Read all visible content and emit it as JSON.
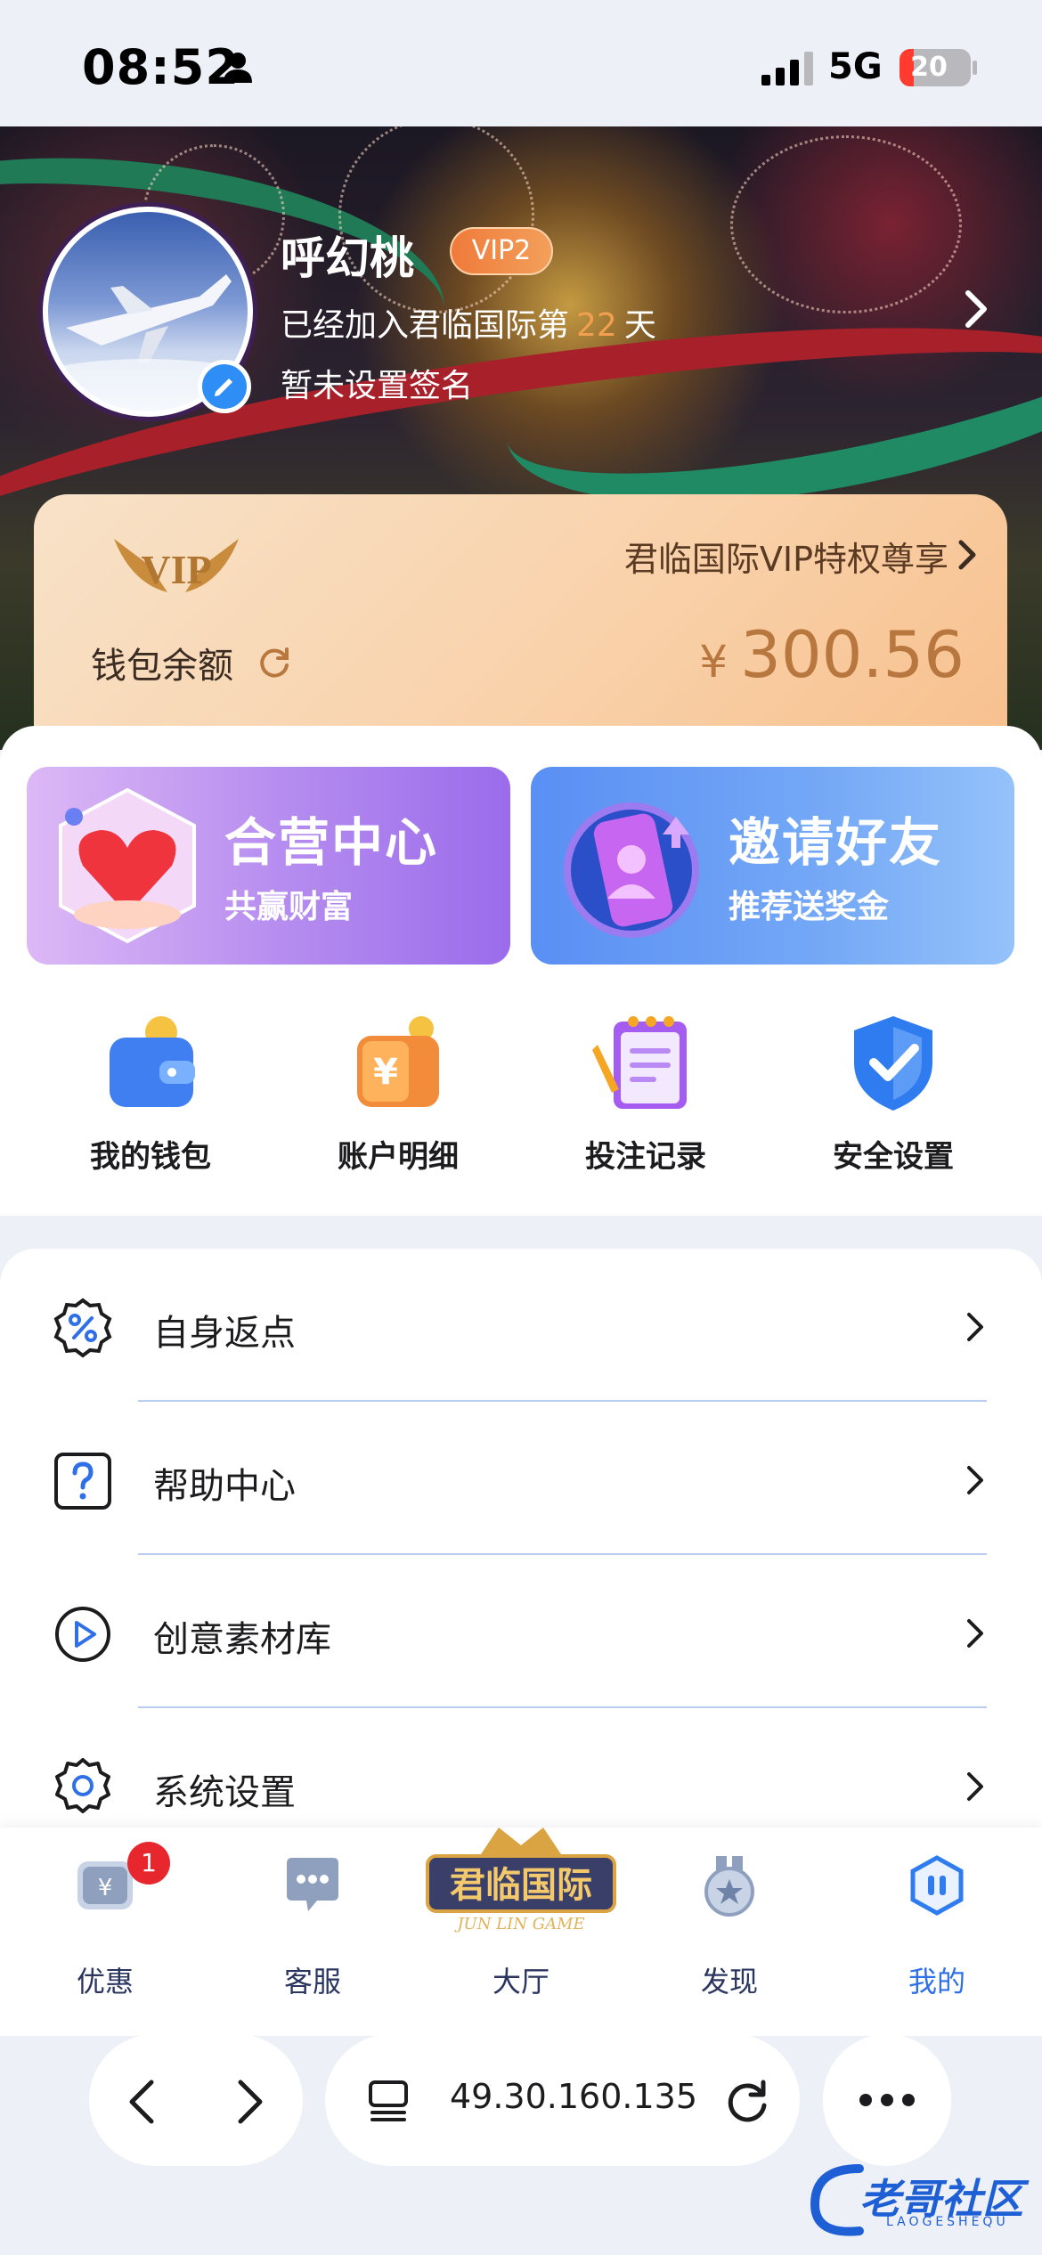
{
  "status_bar": {
    "time": "08:52",
    "network": "5G",
    "battery_level": "20",
    "battery_fill_fraction": 0.2
  },
  "profile": {
    "name": "呼幻桃",
    "vip_level": "VIP2",
    "joined_prefix": "已经加入君临国际第",
    "joined_days": "22",
    "joined_suffix": "天",
    "signature": "暂未设置签名"
  },
  "vip_card": {
    "logo_text": "VIP",
    "privilege_text": "君临国际VIP特权尊享",
    "wallet_label": "钱包余额",
    "currency": "¥",
    "balance": "300.56"
  },
  "promos": [
    {
      "title": "合营中心",
      "subtitle": "共赢财富"
    },
    {
      "title": "邀请好友",
      "subtitle": "推荐送奖金"
    }
  ],
  "shortcuts": [
    {
      "label": "我的钱包",
      "icon": "wallet-icon"
    },
    {
      "label": "账户明细",
      "icon": "account-details-icon"
    },
    {
      "label": "投注记录",
      "icon": "bet-record-icon"
    },
    {
      "label": "安全设置",
      "icon": "shield-check-icon"
    }
  ],
  "menu": [
    {
      "label": "自身返点",
      "icon": "percent-badge-icon"
    },
    {
      "label": "帮助中心",
      "icon": "help-question-icon"
    },
    {
      "label": "创意素材库",
      "icon": "play-circle-icon"
    },
    {
      "label": "系统设置",
      "icon": "gear-icon"
    }
  ],
  "tabbar": {
    "items": [
      {
        "label": "优惠",
        "icon": "coupon-icon",
        "badge": "1"
      },
      {
        "label": "客服",
        "icon": "chat-bubble-icon"
      },
      {
        "label": "大厅",
        "icon": "lobby-logo-icon"
      },
      {
        "label": "发现",
        "icon": "star-medal-icon"
      },
      {
        "label": "我的",
        "icon": "hexagon-pause-icon",
        "active": true
      }
    ],
    "lobby_logo_text": "君临国际",
    "lobby_logo_sub": "JUN LIN GAME"
  },
  "browser": {
    "url": "49.30.160.135"
  },
  "watermark": {
    "text": "老哥社区",
    "sub": "LAOGESHEQU"
  },
  "colors": {
    "accent": "#2f6fe8",
    "badge": "#e8262d",
    "balance": "#b8773e",
    "vip_badge": "#f07a3a"
  }
}
